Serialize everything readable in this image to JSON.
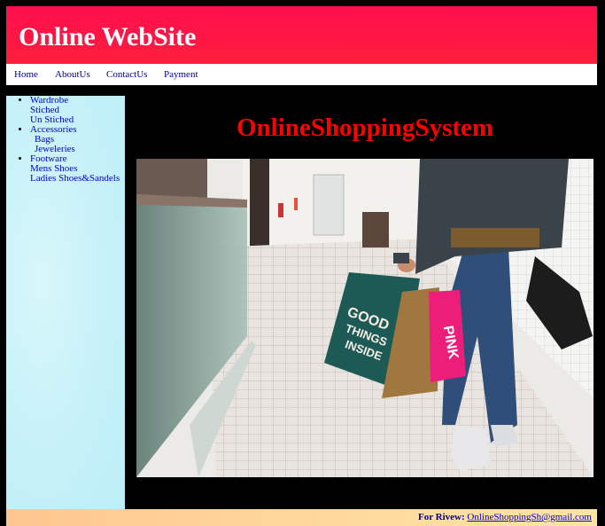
{
  "header": {
    "title": "Online WebSite"
  },
  "nav": {
    "items": [
      "Home",
      "AboutUs",
      "ContactUs",
      "Payment"
    ]
  },
  "sidebar": {
    "groups": [
      {
        "label": "Wardrobe",
        "items": [
          "Stiched",
          "Un Stiched"
        ]
      },
      {
        "label": "Accessories",
        "items": [
          "Bags",
          "Jeweleries"
        ]
      },
      {
        "label": "Footware",
        "items": [
          "Mens Shoes",
          "Ladies Shoes&Sandels"
        ]
      }
    ]
  },
  "main": {
    "title": "OnlineShoppingSystem",
    "bag_texts": {
      "green": "GOOD THINGS INSIDE",
      "pink": "PINK"
    }
  },
  "footer": {
    "label": "For Rivew:",
    "email": "OnlineShoppingSh@gmail.com"
  },
  "colors": {
    "header": "#ff1744",
    "title": "#ff0000",
    "sidebar": "#c6f1f8",
    "footer": "#ffd49a"
  }
}
